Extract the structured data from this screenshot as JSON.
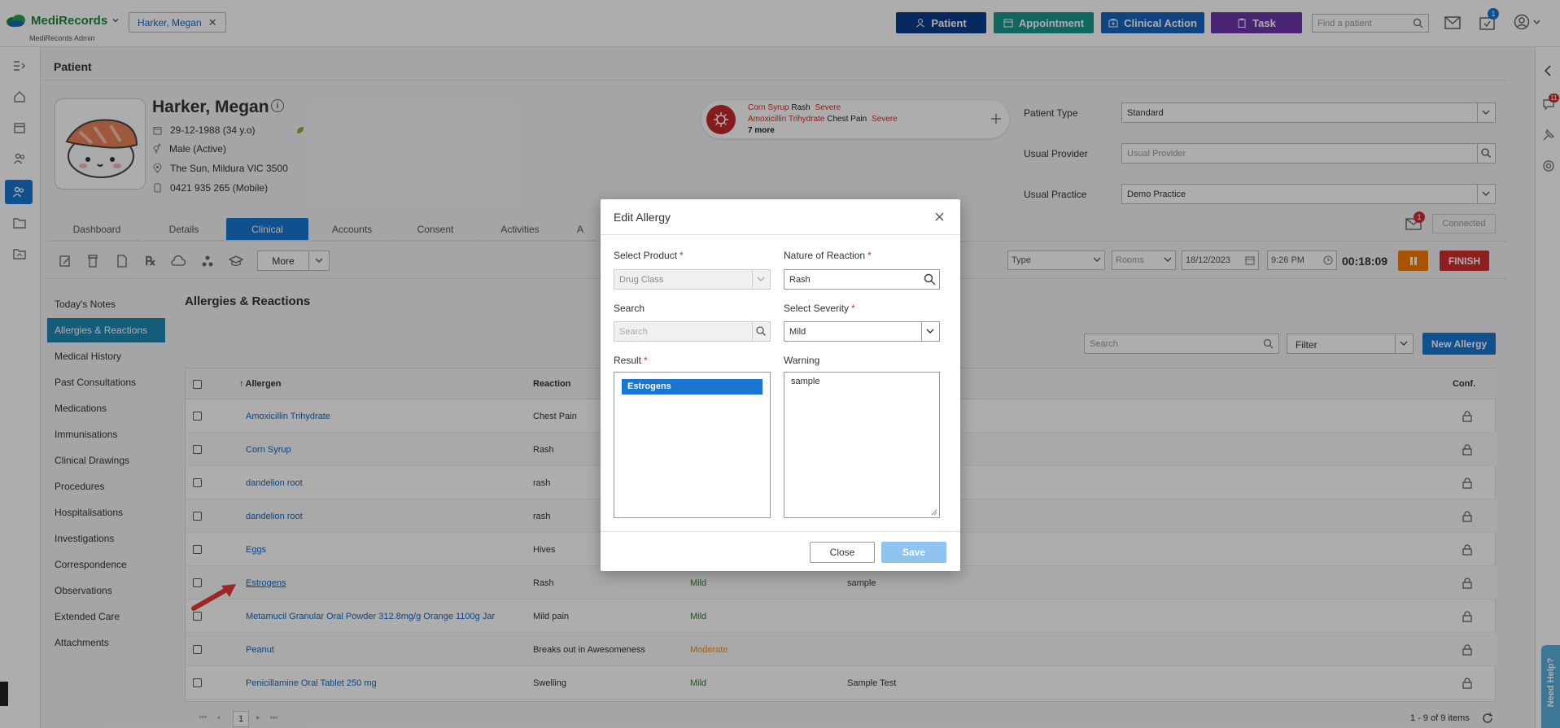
{
  "app": {
    "brand": "MediRecords",
    "subtitle": "MediRecords Admin",
    "open_patient_tab": "Harker, Megan",
    "buttons": {
      "patient": "Patient",
      "appointment": "Appointment",
      "clinical_action": "Clinical Action",
      "task": "Task"
    },
    "find_placeholder": "Find a patient",
    "tasks_badge": "1",
    "notif_badge": "11"
  },
  "page": {
    "title": "Patient"
  },
  "patient": {
    "name": "Harker, Megan",
    "dob": "29-12-1988 (34 y.o)",
    "gender": "Male (Active)",
    "address": "The Sun, Mildura VIC 3500",
    "phone": "0421 935 265 (Mobile)"
  },
  "alerts": {
    "line1": {
      "allergen": "Corn Syrup",
      "reaction": "Rash",
      "severity": "Severe"
    },
    "line2": {
      "allergen": "Amoxicillin Trihydrate",
      "reaction": "Chest Pain",
      "severity": "Severe"
    },
    "more": "7 more"
  },
  "patient_fields": {
    "type_label": "Patient Type",
    "type_value": "Standard",
    "provider_label": "Usual Provider",
    "provider_placeholder": "Usual Provider",
    "practice_label": "Usual Practice",
    "practice_value": "Demo Practice",
    "mail_badge": "1",
    "connected": "Connected"
  },
  "tabs": [
    "Dashboard",
    "Details",
    "Clinical",
    "Accounts",
    "Consent",
    "Activities",
    "A"
  ],
  "toolbar": {
    "more": "More",
    "type": "Type",
    "rooms": "Rooms",
    "date": "18/12/2023",
    "time": "9:26 PM",
    "timer": "00:18:09",
    "finish": "FINISH"
  },
  "side_nav": [
    "Today's Notes",
    "Allergies & Reactions",
    "Medical History",
    "Past Consultations",
    "Medications",
    "Immunisations",
    "Clinical Drawings",
    "Procedures",
    "Hospitalisations",
    "Investigations",
    "Correspondence",
    "Observations",
    "Extended Care",
    "Attachments"
  ],
  "section": {
    "title": "Allergies & Reactions",
    "search_placeholder": "Search",
    "filter": "Filter",
    "new_allergy": "New Allergy"
  },
  "table": {
    "headers": {
      "allergen": "Allergen",
      "reaction": "Reaction",
      "conf": "Conf."
    },
    "rows": [
      {
        "allergen": "Amoxicillin Trihydrate",
        "reaction": "Chest Pain",
        "severity": "",
        "warning": ""
      },
      {
        "allergen": "Corn Syrup",
        "reaction": "Rash",
        "severity": "",
        "warning": ""
      },
      {
        "allergen": "dandelion root",
        "reaction": "rash",
        "severity": "",
        "warning": ""
      },
      {
        "allergen": "dandelion root",
        "reaction": "rash",
        "severity": "",
        "warning": ""
      },
      {
        "allergen": "Eggs",
        "reaction": "Hives",
        "severity": "",
        "warning": ""
      },
      {
        "allergen": "Estrogens",
        "reaction": "Rash",
        "severity": "Mild",
        "warning": "sample"
      },
      {
        "allergen": "Metamucil Granular Oral Powder 312.8mg/g Orange 1100g Jar",
        "reaction": "Mild pain",
        "severity": "Mild",
        "warning": ""
      },
      {
        "allergen": "Peanut",
        "reaction": "Breaks out in Awesomeness",
        "severity": "Moderate",
        "warning": ""
      },
      {
        "allergen": "Penicillamine Oral Tablet 250 mg",
        "reaction": "Swelling",
        "severity": "Mild",
        "warning": "Sample Test"
      }
    ],
    "page": "1",
    "summary": "1 - 9 of 9 items"
  },
  "modal": {
    "title": "Edit Allergy",
    "select_product_label": "Select Product",
    "select_product_value": "Drug Class",
    "nature_label": "Nature of Reaction",
    "nature_value": "Rash",
    "search_label": "Search",
    "search_placeholder": "Search",
    "severity_label": "Select Severity",
    "severity_value": "Mild",
    "result_label": "Result",
    "result_selected": "Estrogens",
    "warning_label": "Warning",
    "warning_value": "sample",
    "close_button": "Close",
    "save_button": "Save"
  },
  "help_tab": "Need Help?",
  "colors": {
    "patient_btn": "#0d3d8c",
    "appointment_btn": "#17998e",
    "clinical_action_btn": "#1565c0",
    "task_btn": "#6a35a8",
    "accent": "#1976d2",
    "finish": "#d32f2f",
    "pause": "#f57c00",
    "mild": "#2e7d32",
    "moderate": "#ef8c1a"
  }
}
